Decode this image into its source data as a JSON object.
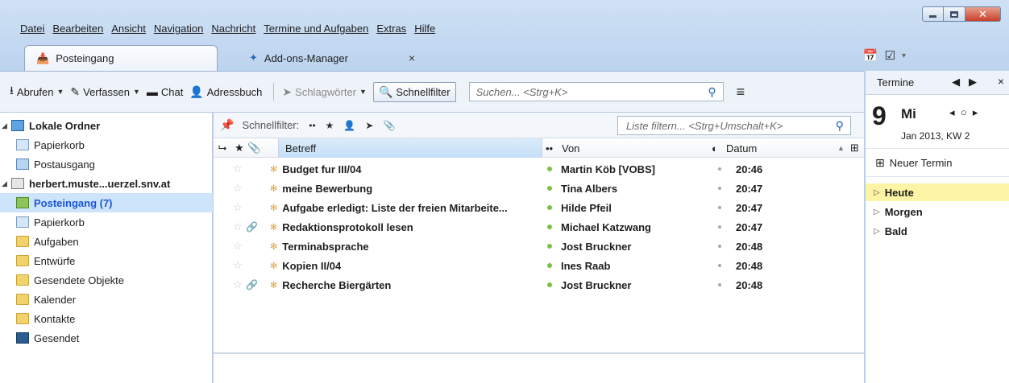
{
  "menu": [
    "Datei",
    "Bearbeiten",
    "Ansicht",
    "Navigation",
    "Nachricht",
    "Termine und Aufgaben",
    "Extras",
    "Hilfe"
  ],
  "tabs": [
    {
      "label": "Posteingang",
      "icon": "inbox-icon"
    },
    {
      "label": "Add-ons-Manager",
      "icon": "puzzle-icon",
      "close": "×"
    }
  ],
  "toolbar": {
    "get_messages": "Abrufen",
    "write": "Verfassen",
    "chat": "Chat",
    "address_book": "Adressbuch",
    "tags": "Schlagwörter",
    "quick_filter": "Schnellfilter",
    "search_placeholder": "Suchen... <Strg+K>"
  },
  "folders": [
    {
      "label": "Lokale Ordner",
      "kind": "pc",
      "level": 0,
      "twisty": "◢",
      "bold": true
    },
    {
      "label": "Papierkorb",
      "kind": "trash",
      "level": 1
    },
    {
      "label": "Postausgang",
      "kind": "outbox",
      "level": 1
    },
    {
      "label": "herbert.muste...uerzel.snv.at",
      "kind": "acct",
      "level": 0,
      "twisty": "◢",
      "bold": true
    },
    {
      "label": "Posteingang (7)",
      "kind": "inbox",
      "level": 1,
      "selected": true
    },
    {
      "label": "Papierkorb",
      "kind": "trash",
      "level": 1
    },
    {
      "label": "Aufgaben",
      "kind": "folder",
      "level": 1
    },
    {
      "label": "Entwürfe",
      "kind": "folder",
      "level": 1
    },
    {
      "label": "Gesendete Objekte",
      "kind": "folder",
      "level": 1
    },
    {
      "label": "Kalender",
      "kind": "folder",
      "level": 1
    },
    {
      "label": "Kontakte",
      "kind": "folder",
      "level": 1
    },
    {
      "label": "Gesendet",
      "kind": "sent",
      "level": 1
    }
  ],
  "quickfilter": {
    "label": "Schnellfilter:",
    "placeholder": "Liste filtern... <Strg+Umschalt+K>"
  },
  "columns": {
    "subject": "Betreff",
    "from": "Von",
    "date": "Datum"
  },
  "messages": [
    {
      "subject": "Budget fur III/04",
      "from": "Martin Köb [VOBS]",
      "date": "20:46",
      "attachment": false
    },
    {
      "subject": "meine Bewerbung",
      "from": "Tina Albers",
      "date": "20:47",
      "attachment": false
    },
    {
      "subject": "Aufgabe erledigt: Liste der freien Mitarbeite...",
      "from": "Hilde Pfeil",
      "date": "20:47",
      "attachment": false
    },
    {
      "subject": "Redaktionsprotokoll lesen",
      "from": "Michael Katzwang",
      "date": "20:47",
      "attachment": true
    },
    {
      "subject": "Terminabsprache",
      "from": "Jost Bruckner",
      "date": "20:48",
      "attachment": false
    },
    {
      "subject": "Kopien II/04",
      "from": "Ines Raab",
      "date": "20:48",
      "attachment": false
    },
    {
      "subject": "Recherche Biergärten",
      "from": "Jost Bruckner",
      "date": "20:48",
      "attachment": true
    }
  ],
  "today": {
    "title": "Termine",
    "day": "9",
    "weekday": "Mi",
    "month_line": "Jan 2013, KW 2",
    "new_event": "Neuer Termin",
    "sections": [
      "Heute",
      "Morgen",
      "Bald"
    ]
  },
  "colors": {
    "selection": "#cde4fb",
    "today_highlight": "#fdf4a5",
    "unread_dot": "#7cc242"
  }
}
